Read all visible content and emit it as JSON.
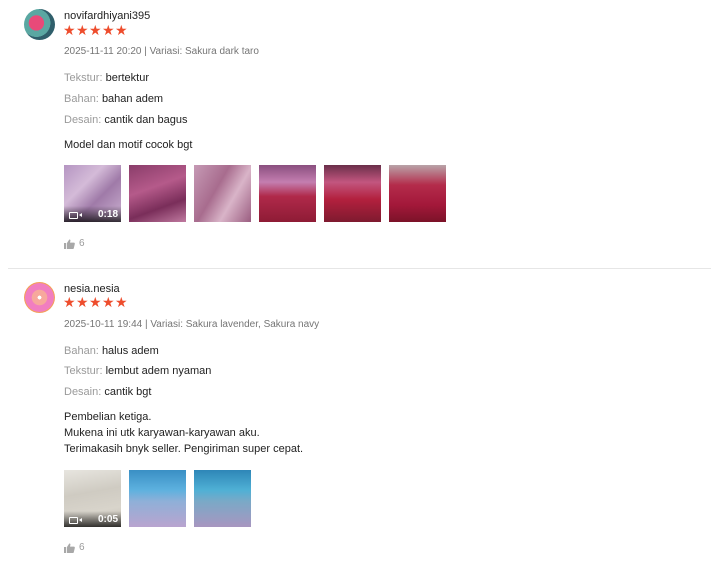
{
  "reviews": [
    {
      "username": "novifardhiyani395",
      "rating": 5,
      "meta": "2025-11-11 20:20 | Variasi: Sakura dark taro",
      "attributes": [
        {
          "key": "Tekstur:",
          "value": "bertektur"
        },
        {
          "key": "Bahan:",
          "value": "bahan adem"
        },
        {
          "key": "Desain:",
          "value": "cantik dan bagus"
        }
      ],
      "comment": "Model dan motif cocok bgt",
      "video_duration": "0:18",
      "media_count": 6,
      "likes": "6"
    },
    {
      "username": "nesia.nesia",
      "rating": 5,
      "meta": "2025-10-11 19:44 | Variasi: Sakura lavender, Sakura navy",
      "attributes": [
        {
          "key": "Bahan:",
          "value": "halus adem"
        },
        {
          "key": "Tekstur:",
          "value": "lembut adem nyaman"
        },
        {
          "key": "Desain:",
          "value": "cantik bgt"
        }
      ],
      "comment_lines": [
        "Pembelian ketiga.",
        "Mukena ini utk karyawan-karyawan aku.",
        "Terimakasih bnyk seller. Pengiriman super cepat."
      ],
      "video_duration": "0:05",
      "media_count": 3,
      "likes": "6"
    }
  ],
  "colors": {
    "star": "#ee4d2d",
    "muted_text": "#757575",
    "attribute_key": "#9a9a9a"
  },
  "icons": {
    "star": "star-icon",
    "like": "thumbs-up-icon",
    "video": "video-camera-icon"
  }
}
